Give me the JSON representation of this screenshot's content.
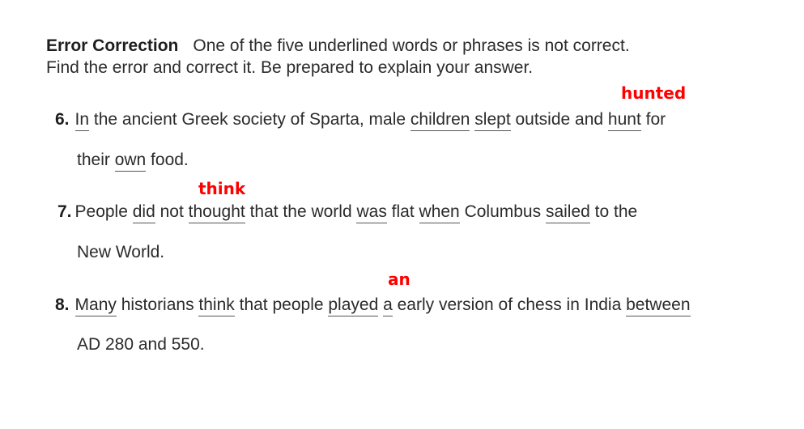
{
  "instructions": {
    "heading": "Error Correction",
    "text_line1": "One of the five underlined words or phrases is not correct.",
    "text_line2": "Find the error and correct it. Be prepared to explain your answer."
  },
  "items": [
    {
      "number": "6.",
      "correction": "hunted",
      "line1": {
        "w1": "In",
        "t1": " the ancient Greek society of Sparta, male ",
        "w2": "children",
        "w3": "slept",
        "t2": " outside and ",
        "w4": "hunt",
        "t3": " for"
      },
      "line2": {
        "t1": "their ",
        "w5": "own",
        "t2": " food."
      }
    },
    {
      "number": "7.",
      "correction": "think",
      "line1": {
        "t0": "People ",
        "w1": "did",
        "t1": " not ",
        "w2": "thought",
        "t2": " that the world ",
        "w3": "was",
        "t3": " flat ",
        "w4": "when",
        "t4": " Columbus ",
        "w5": "sailed",
        "t5": " to the"
      },
      "line2": {
        "t1": "New World."
      }
    },
    {
      "number": "8.",
      "correction": "an",
      "line1": {
        "w1": "Many",
        "t1": " historians ",
        "w2": "think",
        "t2": " that people ",
        "w3": "played",
        "w4": "a",
        "t3": " early version of chess in India ",
        "w5": "between"
      },
      "line2": {
        "t1": "AD 280 and 550."
      }
    }
  ],
  "colors": {
    "correction": "#ff0000",
    "text": "#2b2b2b"
  }
}
